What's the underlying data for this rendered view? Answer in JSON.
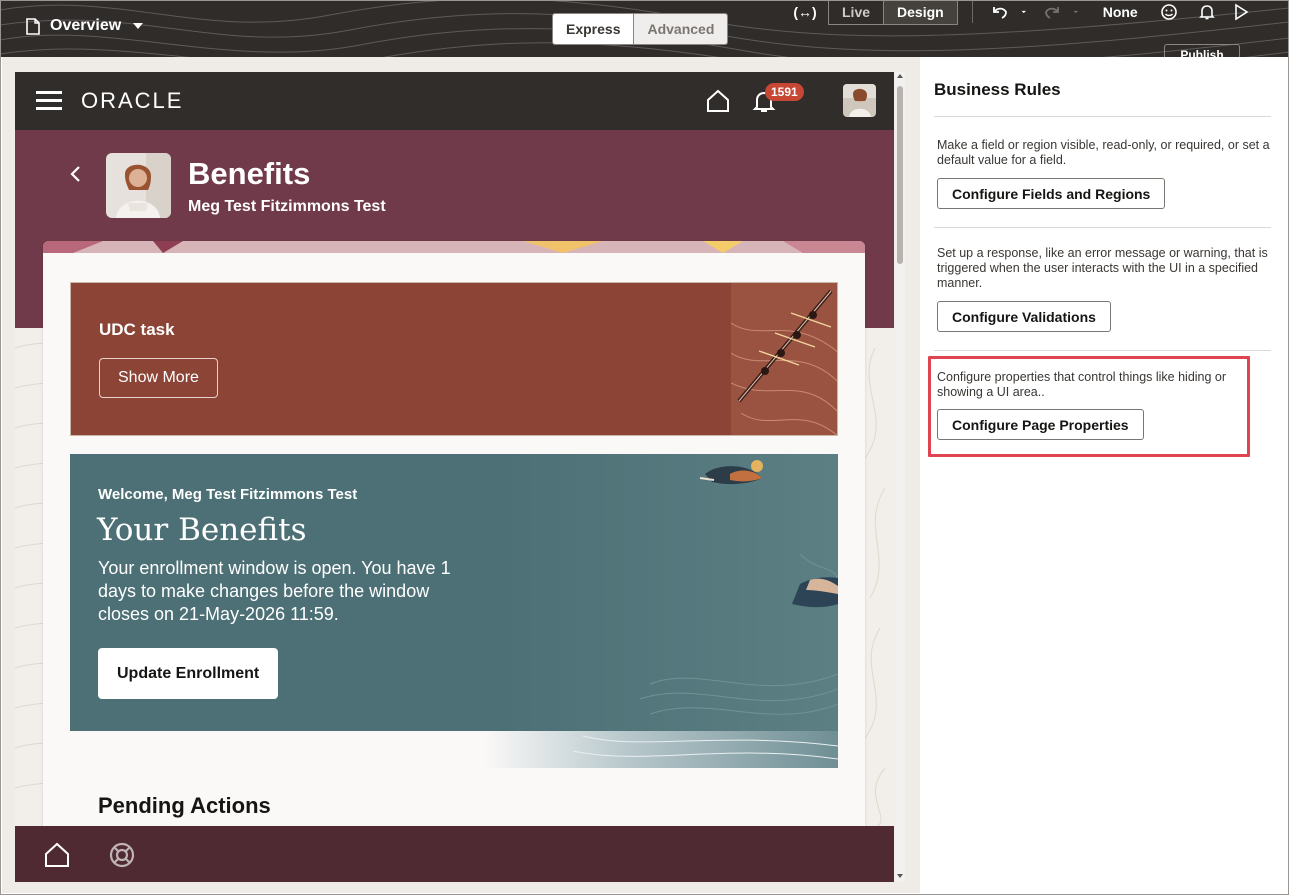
{
  "editor": {
    "page_name": "Overview",
    "mode_express": "Express",
    "mode_advanced": "Advanced",
    "code_symbol": "(↔)",
    "live_label": "Live",
    "design_label": "Design",
    "sandbox_label": "None",
    "publish_label": "Publish"
  },
  "app": {
    "logo_text": "ORACLE",
    "notification_count": "1591",
    "page_title": "Benefits",
    "person_name": "Meg Test Fitzimmons Test"
  },
  "udc": {
    "title": "UDC task",
    "show_more": "Show More"
  },
  "benefits": {
    "welcome": "Welcome, Meg Test Fitzimmons Test",
    "title": "Your Benefits",
    "text": "Your enrollment window is open. You have 1 days to make changes before the window closes on 21-May-2026 11:59.",
    "update_button": "Update Enrollment"
  },
  "pending": {
    "title": "Pending Actions"
  },
  "rules": {
    "title": "Business Rules",
    "items": [
      {
        "text": "Make a field or region visible, read-only, or required, or set a default value for a field.",
        "button": "Configure Fields and Regions"
      },
      {
        "text": "Set up a response, like an error message or warning, that is triggered when the user interacts with the UI in a specified manner.",
        "button": "Configure Validations"
      },
      {
        "text": "Configure properties that control things like hiding or showing a UI area..",
        "button": "Configure Page Properties"
      }
    ]
  },
  "colors": {
    "toolbar": "#2f2c2a",
    "app_header": "#312d2a",
    "hero": "#703a4a",
    "udc_card": "#8b4436",
    "benefits_card": "#4c7075",
    "bottom_nav": "#4f2a33",
    "badge": "#c74634",
    "highlight": "#e0454f"
  },
  "icons": [
    "document-icon",
    "chevron-down-icon",
    "code-icon",
    "undo-icon",
    "redo-icon",
    "smiley-icon",
    "bell-icon",
    "play-icon",
    "hamburger-icon",
    "home-icon",
    "back-chevron-icon",
    "help-icon"
  ]
}
